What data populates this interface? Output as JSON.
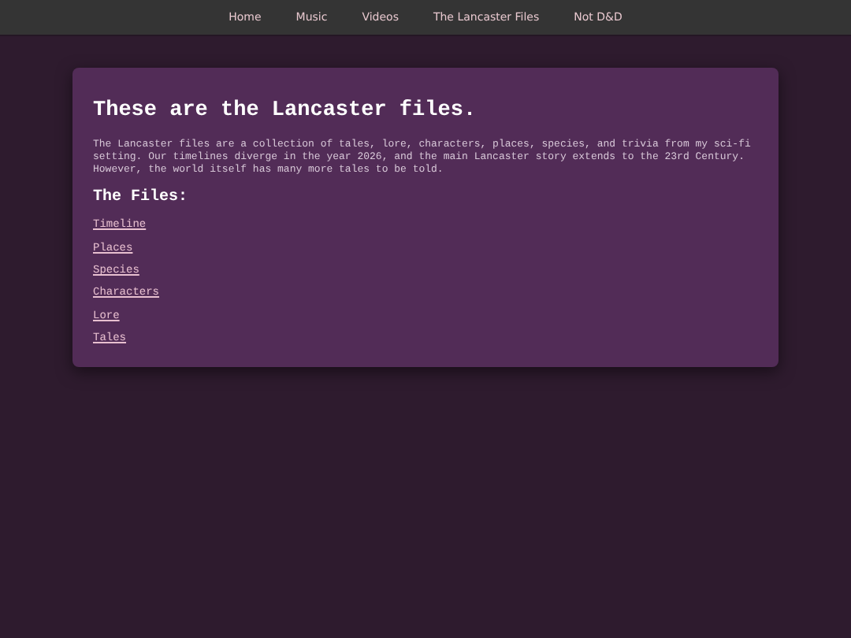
{
  "nav": [
    {
      "label": "Home"
    },
    {
      "label": "Music"
    },
    {
      "label": "Videos"
    },
    {
      "label": "The Lancaster Files"
    },
    {
      "label": "Not D&D"
    }
  ],
  "card": {
    "title": "These are the Lancaster files.",
    "intro": "The Lancaster files are a collection of tales, lore, characters, places, species, and trivia from my sci-fi setting. Our timelines diverge in the year 2026, and the main Lancaster story extends to the 23rd Century. However, the world itself has many more tales to be told.",
    "heading": "The Files:",
    "links": [
      {
        "label": "Timeline"
      },
      {
        "label": "Places"
      },
      {
        "label": "Species"
      },
      {
        "label": "Characters"
      },
      {
        "label": "Lore"
      },
      {
        "label": "Tales"
      }
    ]
  }
}
